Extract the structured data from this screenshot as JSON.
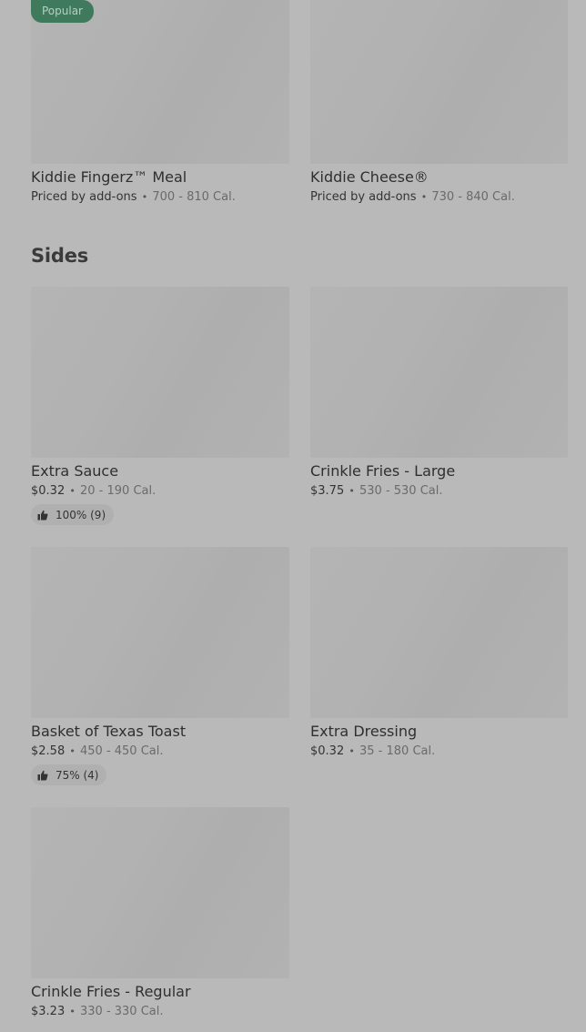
{
  "top_items": [
    {
      "badge": "Popular",
      "name": "Kiddie Fingerz™ Meal",
      "price": "Priced by add-ons",
      "calories": "700 - 810 Cal."
    },
    {
      "name": "Kiddie Cheese®",
      "price": "Priced by add-ons",
      "calories": "730 - 840 Cal."
    }
  ],
  "sides": {
    "title": "Sides",
    "items": [
      {
        "name": "Extra Sauce",
        "price": "$0.32",
        "calories": "20 - 190 Cal.",
        "rating": "100% (9)"
      },
      {
        "name": "Crinkle Fries - Large",
        "price": "$3.75",
        "calories": "530 - 530 Cal."
      },
      {
        "name": "Basket of Texas Toast",
        "price": "$2.58",
        "calories": "450 - 450 Cal.",
        "rating": "75% (4)"
      },
      {
        "name": "Extra Dressing",
        "price": "$0.32",
        "calories": "35 - 180 Cal."
      },
      {
        "name": "Crinkle Fries - Regular",
        "price": "$3.23",
        "calories": "330 - 330 Cal."
      }
    ]
  },
  "separator": "•",
  "icons": {
    "rating": "thumbs-up-icon"
  }
}
